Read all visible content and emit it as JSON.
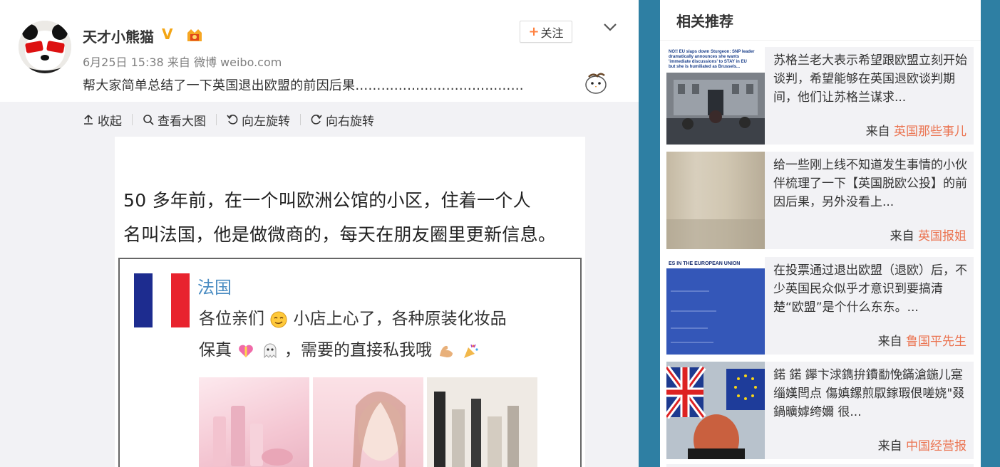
{
  "post": {
    "username": "天才小熊猫",
    "verified_mark": "V",
    "date": "6月25日 15:38",
    "from_label": "来自",
    "source": "微博 weibo.com",
    "text": "帮大家简单总结了一下英国退出欧盟的前因后果…………………………………",
    "follow": {
      "plus": "+",
      "label": "关注"
    },
    "toolbar": {
      "collapse": "收起",
      "view_large": "查看大图",
      "rotate_left": "向左旋转",
      "rotate_right": "向右旋转"
    },
    "image": {
      "line1": "50 多年前，在一个叫欧洲公馆的小区，住着一个人",
      "line2": "名叫法国，他是做微商的，每天在朋友圈里更新信息。",
      "chat_name": "法国",
      "chat_line1_a": "各位亲们",
      "chat_line1_b": "小店上心了，各种原装化妆品",
      "chat_line2_a": "保真",
      "chat_line2_b": "，需要的直接私我哦",
      "flag_colors": [
        "#1d2c8f",
        "#ffffff",
        "#e8232e"
      ]
    }
  },
  "sidebar": {
    "title": "相关推荐",
    "from_label": "来自",
    "items": [
      {
        "desc": "苏格兰老大表示希望跟欧盟立刻开始谈判，希望能够在英国退欧谈判期间，他们让苏格兰谋求...",
        "source": "英国那些事儿",
        "thumb_caption": "NO!! EU slaps down Sturgeon: SNP leader dramatically announces she wants 'immediate discussions' to STAY in EU but she is humiliated as Brussels says 'No, that's not how it works'"
      },
      {
        "desc": "给一些刚上线不知道发生事情的小伙伴梳理了一下【英国脱欧公投】的前因后果，另外没看上...",
        "source": "英国报姐"
      },
      {
        "desc": "在投票通过退出欧盟（退欧）后，不少英国民众似乎才意识到要搞清楚“欧盟”是个什么东东。...",
        "source": "鲁国平先生",
        "thumb_caption": "ES IN THE EUROPEAN UNION"
      },
      {
        "desc": "鍩 鍩 鑻卞浗鐫拚鐨勫悗鏋滄鍦儿寔缁嫨閆点 傷嫃鏍煎叞鎵瑕佷嗟娆\"叕鍋曠嫭绔嬭 很...",
        "source": "中国经营报"
      }
    ]
  },
  "colors": {
    "accent_orange": "#eb7350",
    "follow_plus": "#ff8140",
    "verified_gold": "#f3a514",
    "page_bg_blue": "#2e7fa3"
  }
}
